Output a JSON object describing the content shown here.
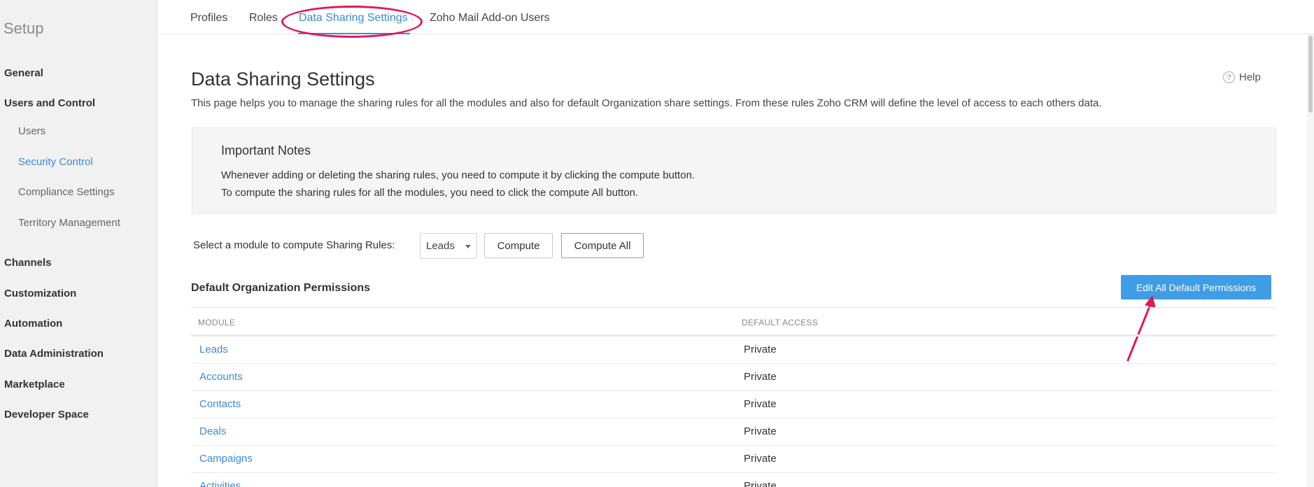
{
  "sidebar": {
    "title": "Setup",
    "items": [
      {
        "label": "General",
        "level": 0
      },
      {
        "label": "Users and Control",
        "level": 0
      },
      {
        "label": "Users",
        "level": 1
      },
      {
        "label": "Security Control",
        "level": 1,
        "active": true
      },
      {
        "label": "Compliance Settings",
        "level": 1
      },
      {
        "label": "Territory Management",
        "level": 1
      },
      {
        "label": "Channels",
        "level": 0
      },
      {
        "label": "Customization",
        "level": 0
      },
      {
        "label": "Automation",
        "level": 0
      },
      {
        "label": "Data Administration",
        "level": 0
      },
      {
        "label": "Marketplace",
        "level": 0
      },
      {
        "label": "Developer Space",
        "level": 0
      }
    ]
  },
  "tabs": [
    {
      "label": "Profiles"
    },
    {
      "label": "Roles"
    },
    {
      "label": "Data Sharing Settings",
      "active": true
    },
    {
      "label": "Zoho Mail Add-on Users"
    }
  ],
  "page": {
    "title": "Data Sharing Settings",
    "help_label": "Help",
    "description": "This page helps you to manage the sharing rules for all the modules and also for default Organization share settings. From these rules Zoho CRM will define the level of access to each others data."
  },
  "notes": {
    "title": "Important Notes",
    "line1": "Whenever adding or deleting the sharing rules, you need to compute it by clicking the compute button.",
    "line2": "To compute the sharing rules for all the modules, you need to click the compute All button."
  },
  "compute": {
    "label": "Select a module to compute Sharing Rules:",
    "selected_module": "Leads",
    "compute_label": "Compute",
    "compute_all_label": "Compute All"
  },
  "permissions": {
    "title": "Default Organization Permissions",
    "edit_all_label": "Edit All Default Permissions",
    "columns": {
      "module": "MODULE",
      "access": "DEFAULT ACCESS"
    },
    "rows": [
      {
        "module": "Leads",
        "access": "Private"
      },
      {
        "module": "Accounts",
        "access": "Private"
      },
      {
        "module": "Contacts",
        "access": "Private"
      },
      {
        "module": "Deals",
        "access": "Private"
      },
      {
        "module": "Campaigns",
        "access": "Private"
      },
      {
        "module": "Activities",
        "access": "Private"
      }
    ]
  },
  "colors": {
    "accent": "#3a8ad6",
    "primary_button": "#3e9de5",
    "annotation": "#e0185a"
  }
}
